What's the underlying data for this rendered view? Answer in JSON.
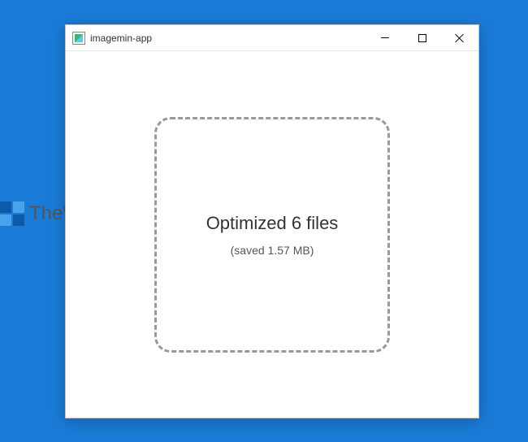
{
  "window": {
    "title": "imagemin-app"
  },
  "result": {
    "title": "Optimized 6 files",
    "saved": "(saved 1.57 MB)"
  },
  "watermark": {
    "text": "TheWindowsClub"
  }
}
